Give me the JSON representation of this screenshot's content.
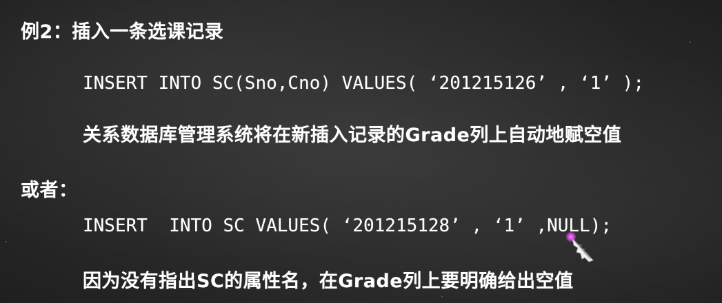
{
  "slide": {
    "example_heading": "例2：插入一条选课记录",
    "sql_insert_1": "INSERT INTO SC(Sno,Cno) VALUES( ‘201215126’ , ‘1’ );",
    "explanation_1": "关系数据库管理系统将在新插入记录的Grade列上自动地赋空值",
    "or_label": "或者：",
    "sql_insert_2": "INSERT  INTO SC VALUES( ‘201215128’ , ‘1’ ,NULL);",
    "explanation_2": "因为没有指出SC的属性名，在Grade列上要明确给出空值"
  },
  "cursor": {
    "icon": "feather-pen-cursor-icon",
    "highlight_color": "#c040d0"
  },
  "colors": {
    "background": "#2a2a2a",
    "text": "#ffffff"
  }
}
